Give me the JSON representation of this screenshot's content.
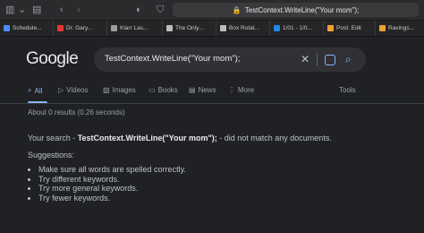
{
  "browser": {
    "url": "TestContext.WriteLine(\"Your mom\");",
    "tabs": [
      {
        "label": "Schedule...",
        "color": "#4a8df6"
      },
      {
        "label": "Dr. Gary...",
        "color": "#e53935"
      },
      {
        "label": "Klarr Las...",
        "color": "#9e9e9e"
      },
      {
        "label": "The Only...",
        "color": "#bdbdbd"
      },
      {
        "label": "Box Rotat...",
        "color": "#bdbdbd"
      },
      {
        "label": "1/01 - 1/0...",
        "color": "#1e88e5"
      },
      {
        "label": "Post: Edit",
        "color": "#f0a030"
      },
      {
        "label": "Ravings...",
        "color": "#f0a030"
      }
    ]
  },
  "google": {
    "logo": "Google",
    "query": "TestContext.WriteLine(\"Your mom\");",
    "nav": {
      "all": "All",
      "videos": "Videos",
      "images": "Images",
      "books": "Books",
      "news": "News",
      "more": "More",
      "tools": "Tools"
    },
    "stats": "About 0 results (0.26 seconds)",
    "message": {
      "prefix": "Your search - ",
      "query": "TestContext.WriteLine(\"Your mom\");",
      "suffix": " - did not match any documents."
    },
    "suggestions_title": "Suggestions:",
    "suggestions": [
      "Make sure all words are spelled correctly.",
      "Try different keywords.",
      "Try more general keywords.",
      "Try fewer keywords."
    ],
    "accent": "#8ab4f8"
  }
}
